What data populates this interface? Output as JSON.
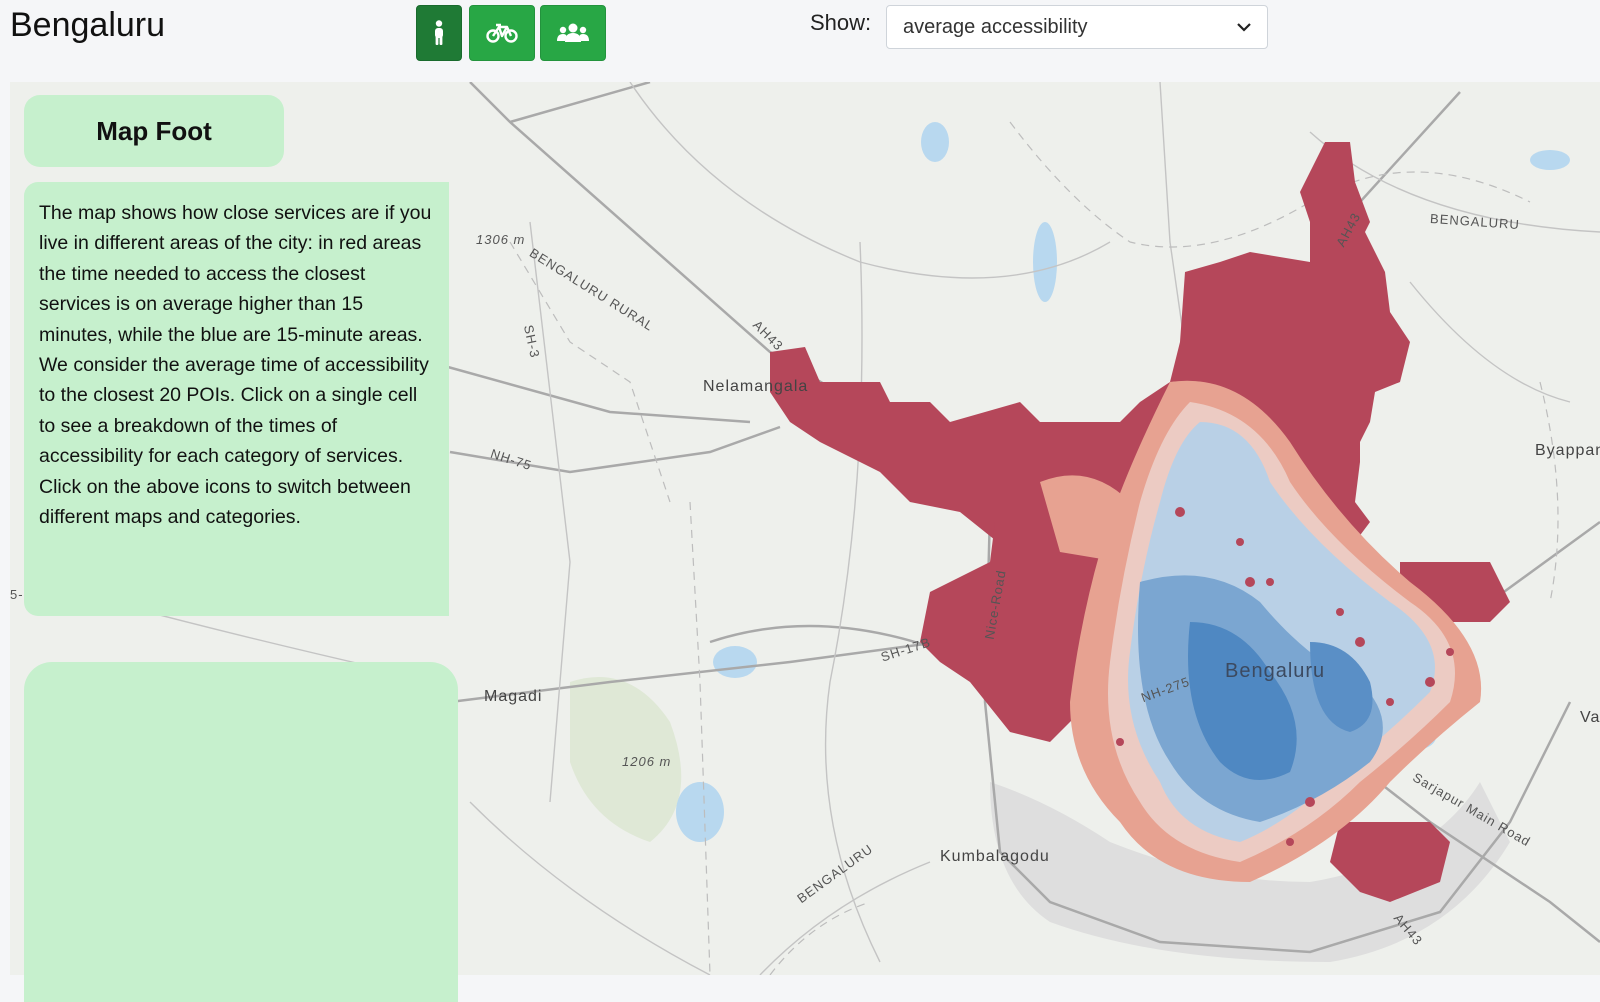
{
  "header": {
    "city": "Bengaluru",
    "show_label": "Show:",
    "select_value": "average accessibility",
    "modes": [
      {
        "icon": "walking-person-icon",
        "active": true
      },
      {
        "icon": "bicycle-icon",
        "active": false
      },
      {
        "icon": "users-group-icon",
        "active": false
      }
    ]
  },
  "panel": {
    "title": "Map Foot",
    "description": "The map shows how close services are if you live in different areas of the city: in red areas the time needed to access the closest services is on average higher than 15 minutes, while the blue are 15-minute areas. We consider the average time of accessibility to the closest 20 POIs. Click on a single cell to see a breakdown of the times of accessibility for each category of services. Click on the above icons to switch between different maps and categories."
  },
  "map": {
    "places": [
      "Nelamangala",
      "Bengaluru",
      "Magadi",
      "Kumbalagodu",
      "Byappan",
      "Va"
    ],
    "roads": [
      "AH43",
      "NH-75",
      "SH-3",
      "SH-17B",
      "NH-275",
      "Sarjapur Main Road",
      "Nice-Road",
      "5-"
    ],
    "region_labels": [
      "BENGALURU RURAL",
      "BENGALURU",
      "BENGALURU"
    ],
    "elevations": [
      "1306 m",
      "1206 m"
    ],
    "colors": {
      "slow": "#b5475a",
      "fast": "#3d7fc0",
      "panel": "#c6f0cd",
      "button": "#28a745"
    }
  }
}
